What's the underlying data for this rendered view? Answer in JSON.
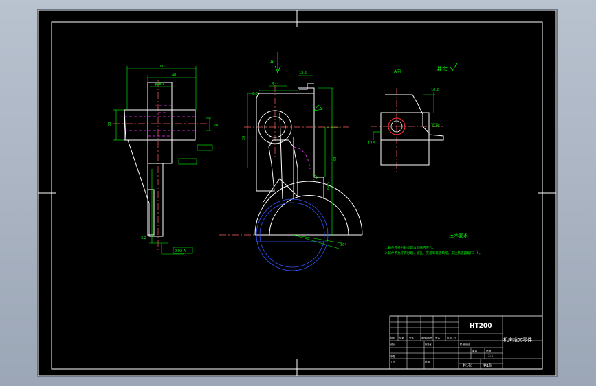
{
  "drawing": {
    "material": "HT200",
    "part_name": "机床拨叉零件",
    "scale_value": "1:1",
    "sheet_count": "共1张",
    "sheet_no": "第1张",
    "roughness_note": "其余",
    "view_label_top": "A",
    "view_label_right": "A向",
    "tech_title": "技术要求",
    "tech_notes": [
      "1.铸件应经时效处理以消除内应力。",
      "2.铸件不允许有砂眼、缩孔、夹渣等铸造缺陷，未注铸造圆角R3~5。"
    ],
    "tb_labels": {
      "mark": "标记",
      "count": "处数",
      "zone": "分区",
      "change_doc": "更改文件号",
      "sign": "签名",
      "date": "年.月.日",
      "design": "设计",
      "standard": "标准化",
      "review": "审核",
      "process": "工艺",
      "approve": "批准",
      "stage": "阶段标记",
      "weight": "重量",
      "scale": "比例"
    },
    "dims": {
      "width_top": "80",
      "width_inner": "40",
      "boss_width": "φ18.1",
      "height_left": "38",
      "right_hub": "20",
      "slot_depth": "20",
      "datum": "0.05",
      "fork_width": "12.5",
      "hole_dia": "φ22",
      "arm_len": "64.5",
      "total_len": "95",
      "fork_angle": "30°",
      "roughness_a": "3.2",
      "roughness_b": "6.3",
      "roughness_c": "12.5",
      "side_w": "10.2",
      "tol_bottom": "0.02 A"
    }
  }
}
